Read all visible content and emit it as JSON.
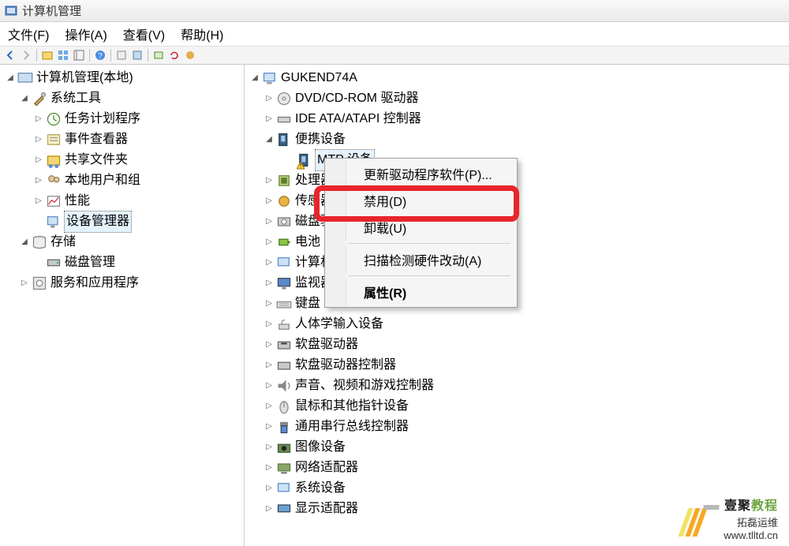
{
  "title": "计算机管理",
  "menu": {
    "file": "文件(F)",
    "action": "操作(A)",
    "view": "查看(V)",
    "help": "帮助(H)"
  },
  "left_tree": {
    "root": "计算机管理(本地)",
    "system_tools": "系统工具",
    "task_scheduler": "任务计划程序",
    "event_viewer": "事件查看器",
    "shared_folders": "共享文件夹",
    "local_users": "本地用户和组",
    "performance": "性能",
    "device_manager": "设备管理器",
    "storage": "存储",
    "disk_mgmt": "磁盘管理",
    "services_apps": "服务和应用程序"
  },
  "right_tree": {
    "computer": "GUKEND74A",
    "dvd": "DVD/CD-ROM 驱动器",
    "ide": "IDE ATA/ATAPI 控制器",
    "portable": "便携设备",
    "mtp": "MTP 设备",
    "cpu": "处理器",
    "sensor": "传感器",
    "disk_drive": "磁盘驱",
    "battery": "电池",
    "computer_cat": "计算机",
    "monitor": "监视器",
    "keyboard": "键盘",
    "hid": "人体学输入设备",
    "floppy": "软盘驱动器",
    "floppy_ctrl": "软盘驱动器控制器",
    "sound": "声音、视频和游戏控制器",
    "mouse": "鼠标和其他指针设备",
    "usb": "通用串行总线控制器",
    "imaging": "图像设备",
    "network": "网络适配器",
    "system_dev": "系统设备",
    "display": "显示适配器"
  },
  "context_menu": {
    "update_driver": "更新驱动程序软件(P)...",
    "disable": "禁用(D)",
    "uninstall": "卸载(U)",
    "scan": "扫描检测硬件改动(A)",
    "properties": "属性(R)"
  },
  "watermark": {
    "line1a": "壹聚",
    "line1b": "教程",
    "line2": "拓磊运维",
    "line3": "www.tlltd.cn"
  }
}
